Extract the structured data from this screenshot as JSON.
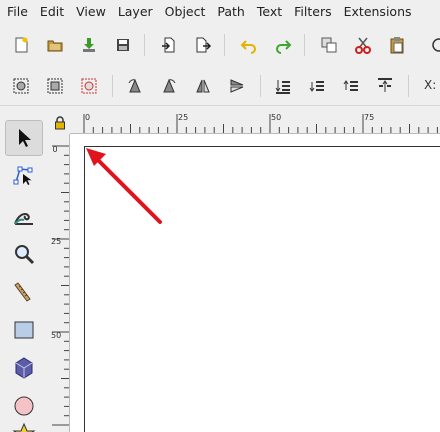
{
  "menubar": {
    "items": [
      "File",
      "Edit",
      "View",
      "Layer",
      "Object",
      "Path",
      "Text",
      "Filters",
      "Extensions"
    ]
  },
  "toolbar_top": {
    "buttons": [
      "new-document-icon",
      "open-document-icon",
      "import-icon",
      "print-icon",
      "import-bitmap-icon",
      "export-icon",
      "undo-icon",
      "redo-icon",
      "duplicate-icon",
      "cut-icon",
      "paste-icon"
    ]
  },
  "toolbar_snap": {
    "buttons": [
      "select-all-icon",
      "select-all-layers-icon",
      "deselect-icon",
      "rotate-ccw-icon",
      "rotate-cw-icon",
      "flip-horizontal-icon",
      "flip-vertical-icon",
      "lower-to-bottom-icon",
      "lower-icon",
      "raise-icon",
      "raise-to-top-icon"
    ],
    "coord_label": "X:"
  },
  "toolbox": {
    "tools": [
      "selector-tool",
      "node-tool",
      "tweak-tool",
      "zoom-tool",
      "measure-tool",
      "rectangle-tool",
      "3d-box-tool",
      "circle-tool",
      "star-tool"
    ],
    "active": "selector-tool"
  },
  "ruler": {
    "h_labels": [
      "0",
      "25",
      "50",
      "75"
    ],
    "v_labels": [
      "0",
      "25",
      "50"
    ]
  },
  "colors": {
    "arrow": "#e0141d",
    "chrome": "#efefef",
    "canvas": "#ffffff"
  }
}
